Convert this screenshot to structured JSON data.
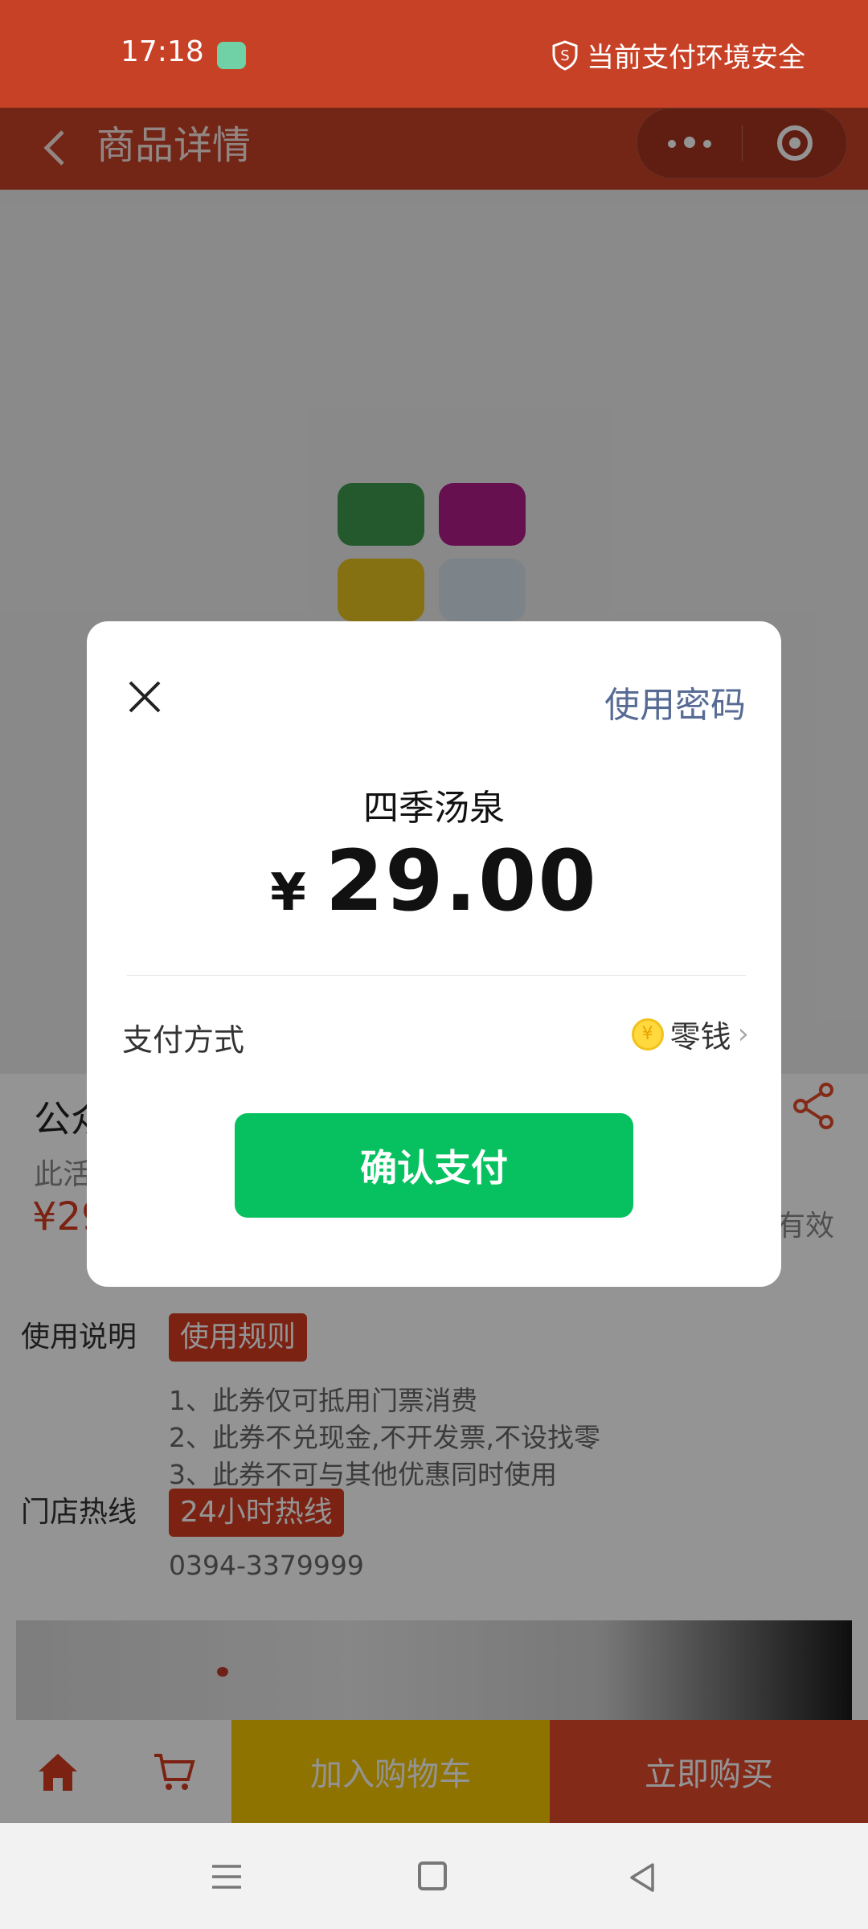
{
  "status_bar": {
    "time": "17:18",
    "secure_text": "当前支付环境安全"
  },
  "nav": {
    "title": "商品详情"
  },
  "product": {
    "title_partial": "公众",
    "subtitle_partial": "此活",
    "price_partial": "¥29",
    "valid_partial": "有效"
  },
  "usage": {
    "label": "使用说明",
    "tag": "使用规则",
    "rules": [
      "1、此券仅可抵用门票消费",
      "2、此券不兑现金,不开发票,不设找零",
      "3、此券不可与其他优惠同时使用"
    ],
    "hotline_label": "门店热线",
    "hotline_tag": "24小时热线",
    "hotline_number": "0394-3379999"
  },
  "bottom_bar": {
    "add_to_cart": "加入购物车",
    "buy_now": "立即购买"
  },
  "dialog": {
    "use_password": "使用密码",
    "merchant": "四季汤泉",
    "currency": "¥",
    "amount": "29.00",
    "payment_method_label": "支付方式",
    "payment_method_value": "零钱",
    "confirm_button": "确认支付"
  },
  "colors": {
    "accent_red": "#c74126",
    "wechat_green": "#07c160",
    "link_blue": "#576b95",
    "cart_yellow": "#f6c700"
  }
}
